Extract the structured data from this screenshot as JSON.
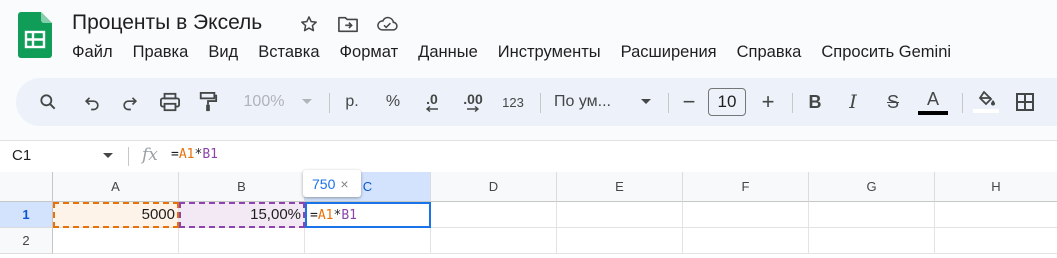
{
  "app": {
    "doc_title": "Проценты в Эксель",
    "title_icons": [
      "star-icon",
      "move-to-folder-icon",
      "cloud-status-icon"
    ]
  },
  "menu": [
    "Файл",
    "Правка",
    "Вид",
    "Вставка",
    "Формат",
    "Данные",
    "Инструменты",
    "Расширения",
    "Справка",
    "Спросить Gemini"
  ],
  "toolbar": {
    "zoom": "100%",
    "currency": "р.",
    "percent": "%",
    "dec_decrease": ".0",
    "dec_increase": ".00",
    "number_format": "123",
    "font": "По ум...",
    "font_size": "10",
    "minus": "−",
    "plus": "+",
    "bold": "B",
    "italic": "I",
    "strike": "S",
    "text_color_label": "A",
    "text_color": "#000000"
  },
  "formula_bar": {
    "cell_ref": "C1",
    "fx": "fx",
    "formula_eq": "=",
    "formula_ref1": "A1",
    "formula_op": "*",
    "formula_ref2": "B1"
  },
  "grid": {
    "columns": [
      "A",
      "B",
      "C",
      "D",
      "E",
      "F",
      "G",
      "H"
    ],
    "rows": [
      "1",
      "2"
    ],
    "cells": {
      "A1": "5000",
      "B1": "15,00%",
      "C1_eq": "=",
      "C1_ref1": "A1",
      "C1_op": "*",
      "C1_ref2": "B1"
    },
    "preview_value": "750",
    "preview_close": "×"
  }
}
